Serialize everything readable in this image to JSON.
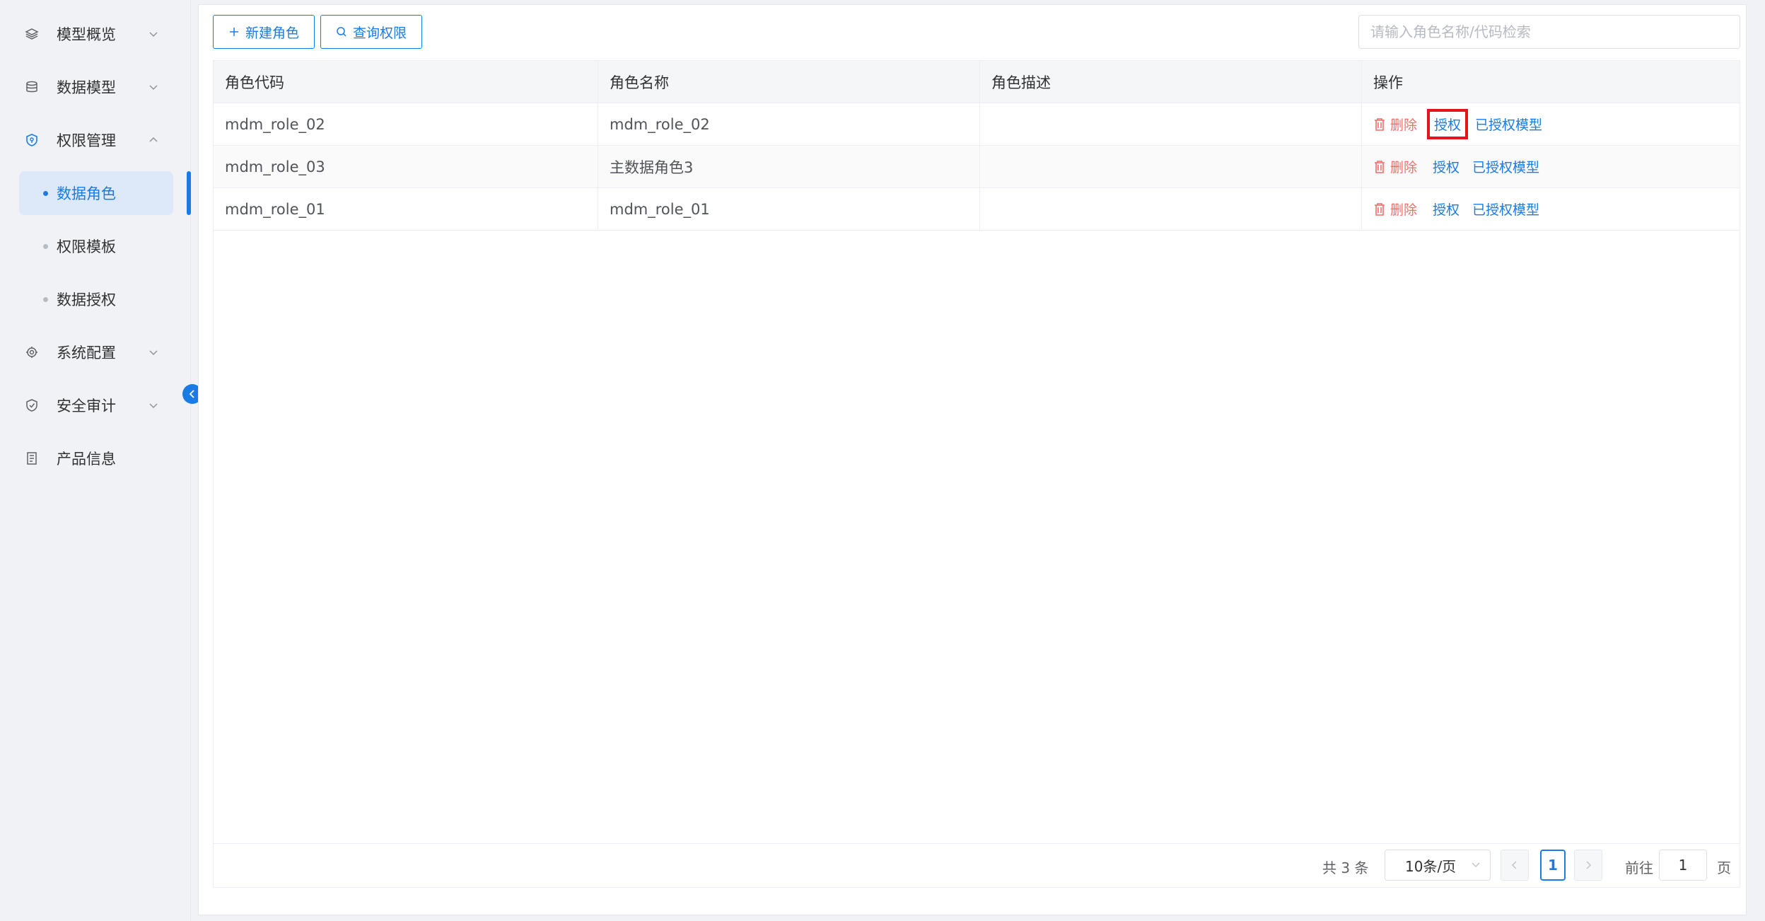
{
  "colors": {
    "primary": "#1a7be6",
    "danger": "#f56c6c",
    "highlight_box": "#e5141b"
  },
  "sidebar": {
    "items": [
      {
        "label": "模型概览",
        "icon": "layers-icon",
        "expanded": false
      },
      {
        "label": "数据模型",
        "icon": "database-icon",
        "expanded": false
      },
      {
        "label": "权限管理",
        "icon": "shield-icon",
        "expanded": true
      },
      {
        "label": "系统配置",
        "icon": "gear-icon",
        "expanded": false
      },
      {
        "label": "安全审计",
        "icon": "shield-check-icon",
        "expanded": false
      },
      {
        "label": "产品信息",
        "icon": "document-icon"
      }
    ],
    "subitems": [
      {
        "label": "数据角色",
        "active": true
      },
      {
        "label": "权限模板",
        "active": false
      },
      {
        "label": "数据授权",
        "active": false
      }
    ]
  },
  "toolbar": {
    "new_role_label": "新建角色",
    "query_perm_label": "查询权限",
    "search_placeholder": "请输入角色名称/代码检索"
  },
  "table": {
    "headers": [
      "角色代码",
      "角色名称",
      "角色描述",
      "操作"
    ],
    "rows": [
      {
        "code": "mdm_role_02",
        "name": "mdm_role_02",
        "desc": ""
      },
      {
        "code": "mdm_role_03",
        "name": "主数据角色3",
        "desc": ""
      },
      {
        "code": "mdm_role_01",
        "name": "mdm_role_01",
        "desc": ""
      }
    ],
    "actions": {
      "delete": "删除",
      "grant": "授权",
      "granted_models": "已授权模型"
    }
  },
  "pagination": {
    "total_text": "共 3 条",
    "page_size": "10条/页",
    "current_page": "1",
    "goto_label": "前往",
    "goto_value": "1",
    "page_unit": "页"
  }
}
